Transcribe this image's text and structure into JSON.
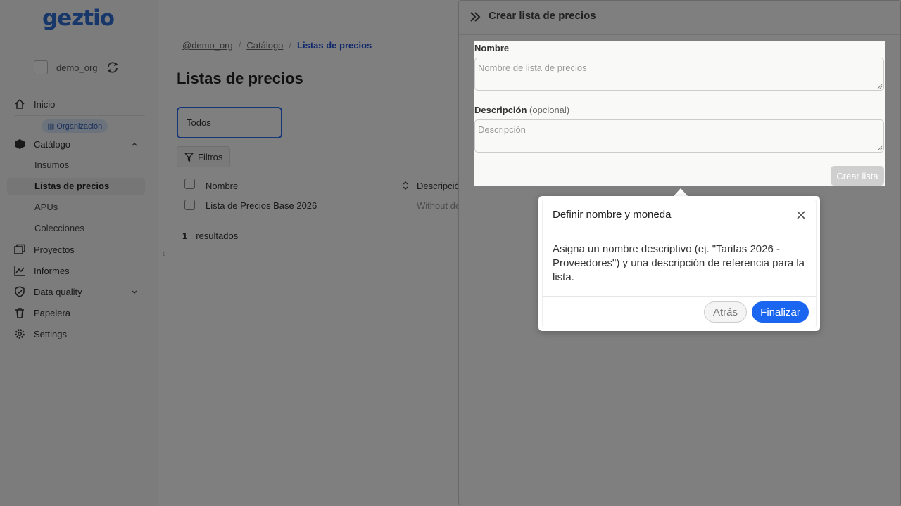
{
  "app": {
    "logo": "geztio"
  },
  "sidebar": {
    "org_name": "demo_org",
    "org_badge": "Organización",
    "items": [
      {
        "label": "Inicio",
        "icon": "home-icon"
      },
      {
        "label": "Catálogo",
        "icon": "cube-icon"
      },
      {
        "label": "Proyectos",
        "icon": "folders-icon"
      },
      {
        "label": "Informes",
        "icon": "chart-icon"
      },
      {
        "label": "Data quality",
        "icon": "shield-check-icon"
      },
      {
        "label": "Papelera",
        "icon": "trash-icon"
      },
      {
        "label": "Settings",
        "icon": "gear-icon"
      }
    ],
    "catalog_sub": [
      "Insumos",
      "Listas de precios",
      "APUs",
      "Colecciones"
    ]
  },
  "main": {
    "breadcrumb": [
      "@demo_org",
      "Catálogo",
      "Listas de precios"
    ],
    "title": "Listas de precios",
    "tab": "Todos",
    "filters_label": "Filtros",
    "columns": [
      "Nombre",
      "Descripción"
    ],
    "rows": [
      {
        "name": "Lista de Precios Base 2026",
        "description": "Without de"
      }
    ],
    "results_count": "1",
    "results_label": "resultados"
  },
  "drawer": {
    "title": "Crear lista de precios",
    "name_label": "Nombre",
    "name_placeholder": "Nombre de lista de precios",
    "desc_label": "Descripción",
    "desc_optional": "(opcional)",
    "desc_placeholder": "Descripción",
    "submit_label": "Crear lista"
  },
  "tour": {
    "title": "Definir nombre y moneda",
    "body": "Asigna un nombre descriptivo (ej. \"Tarifas 2026 - Proveedores\") y una descripción de referencia para la lista.",
    "back_label": "Atrás",
    "finish_label": "Finalizar"
  },
  "colors": {
    "accent": "#1a66f0",
    "breadcrumb_current": "#1d4ed8",
    "overlay": "rgba(0,0,0,0.5)"
  }
}
